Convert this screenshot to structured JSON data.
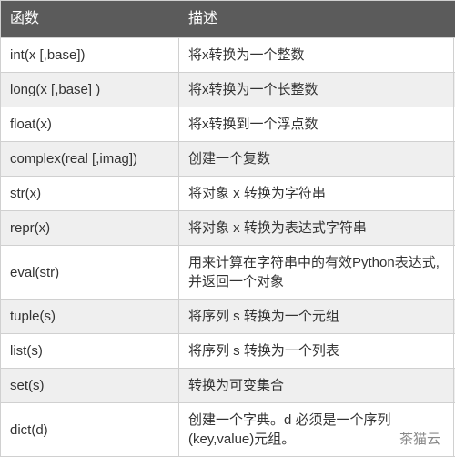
{
  "table": {
    "header": {
      "func": "函数",
      "desc": "描述"
    },
    "rows": [
      {
        "func": "int(x [,base])",
        "desc": "将x转换为一个整数"
      },
      {
        "func": "long(x [,base] )",
        "desc": "将x转换为一个长整数"
      },
      {
        "func": "float(x)",
        "desc": "将x转换到一个浮点数"
      },
      {
        "func": "complex(real [,imag])",
        "desc": "创建一个复数"
      },
      {
        "func": "str(x)",
        "desc": "将对象 x 转换为字符串"
      },
      {
        "func": "repr(x)",
        "desc": "将对象 x 转换为表达式字符串"
      },
      {
        "func": "eval(str)",
        "desc": "用来计算在字符串中的有效Python表达式,并返回一个对象"
      },
      {
        "func": "tuple(s)",
        "desc": "将序列 s 转换为一个元组"
      },
      {
        "func": "list(s)",
        "desc": "将序列 s 转换为一个列表"
      },
      {
        "func": "set(s)",
        "desc": "转换为可变集合"
      },
      {
        "func": "dict(d)",
        "desc": "创建一个字典。d 必须是一个序列 (key,value)元组。"
      }
    ]
  },
  "watermark": "茶猫云"
}
